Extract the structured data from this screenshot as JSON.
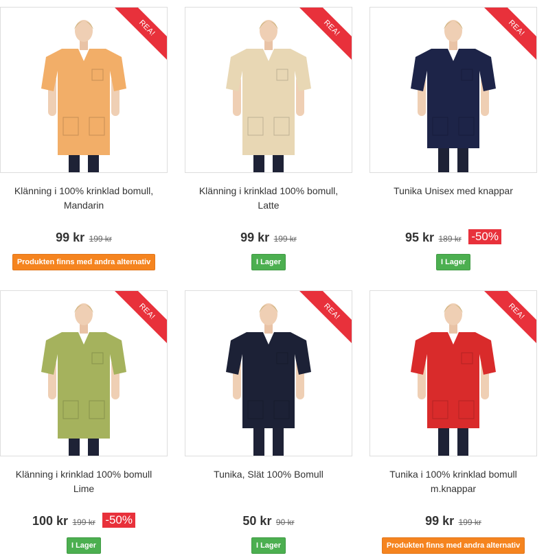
{
  "colors": {
    "sale_red": "#e8313b",
    "stock_green": "#4caf50",
    "alt_orange": "#f5841f"
  },
  "products": [
    {
      "ribbon": "REA!",
      "title": "Klänning i 100% krinklad bomull, Mandarin",
      "price": "99 kr",
      "old_price": "199 kr",
      "discount": "",
      "badge": "Produkten finns med andra alternativ",
      "badge_type": "orange",
      "garment_color": "#f2ae68",
      "garment": "long-dress"
    },
    {
      "ribbon": "REA!",
      "title": "Klänning i krinklad 100% bomull, Latte",
      "price": "99 kr",
      "old_price": "199 kr",
      "discount": "",
      "badge": "I Lager",
      "badge_type": "green",
      "garment_color": "#e8d7b4",
      "garment": "long-dress"
    },
    {
      "ribbon": "REA!",
      "title": "Tunika Unisex med knappar",
      "price": "95 kr",
      "old_price": "189 kr",
      "discount": "-50%",
      "badge": "I Lager",
      "badge_type": "green",
      "garment_color": "#1d2448",
      "garment": "polo"
    },
    {
      "ribbon": "REA!",
      "title": "Klänning i krinklad 100% bomull Lime",
      "price": "100 kr",
      "old_price": "199 kr",
      "discount": "-50%",
      "badge": "I Lager",
      "badge_type": "green",
      "garment_color": "#a5b25d",
      "garment": "long-dress"
    },
    {
      "ribbon": "REA!",
      "title": "Tunika, Slät 100% Bomull",
      "price": "50 kr",
      "old_price": "90 kr",
      "discount": "",
      "badge": "I Lager",
      "badge_type": "green",
      "garment_color": "#1c2136",
      "garment": "tunic"
    },
    {
      "ribbon": "REA!",
      "title": "Tunika i 100% krinklad bomull m.knappar",
      "price": "99 kr",
      "old_price": "199 kr",
      "discount": "",
      "badge": "Produkten finns med andra alternativ",
      "badge_type": "orange",
      "garment_color": "#d92b2b",
      "garment": "tunic"
    }
  ]
}
